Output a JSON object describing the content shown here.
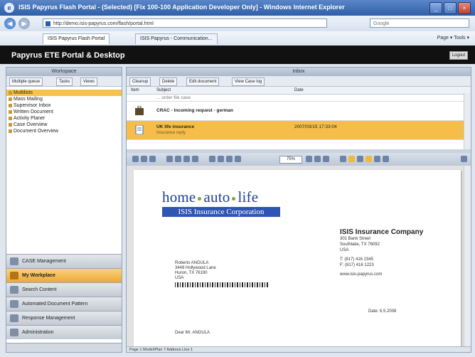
{
  "browser": {
    "title": "ISIS Papyrus Flash Portal - (Selected) [Fix 100-100 Application Developer Only] - Windows Internet Explorer",
    "address": "http://demo.isis-papyrus.com/flash/portal.html",
    "search_placeholder": "Google",
    "tabs": [
      "ISIS Papyrus Flash Portal",
      "ISIS Papyrus - Communication..."
    ],
    "toolbar_text": "Page ▾  Tools ▾"
  },
  "app": {
    "title": "Papyrus ETE Portal & Desktop",
    "logout_label": "Logout"
  },
  "left_panel": {
    "header": "Workspace",
    "buttons": [
      "Multiple queue",
      "Tasks",
      "Views"
    ],
    "tree": [
      {
        "label": "Multilists",
        "selected": true
      },
      {
        "label": "Mass Mailing",
        "selected": false
      },
      {
        "label": "Supervisor Inbox",
        "selected": false
      },
      {
        "label": "Written Document",
        "selected": false
      },
      {
        "label": "Activity Planer",
        "selected": false
      },
      {
        "label": "Case Overview",
        "selected": false
      },
      {
        "label": "Document Overview",
        "selected": false
      }
    ],
    "nav": [
      {
        "label": "CASE Management",
        "active": false
      },
      {
        "label": "My Workplace",
        "active": true
      },
      {
        "label": "Search Content",
        "active": false
      },
      {
        "label": "Automated Document Pattern",
        "active": false
      },
      {
        "label": "Response Management",
        "active": false
      },
      {
        "label": "Administration",
        "active": false
      }
    ]
  },
  "right_panel": {
    "header": "Inbox",
    "buttons": [
      "Cleanup",
      "Delete",
      "Edit document",
      "View Case log"
    ],
    "columns": [
      "Item",
      "Subject",
      "Date"
    ],
    "rows": [
      {
        "subject": "... order file case",
        "from": "",
        "date": ""
      },
      {
        "subject": "CRAC - Incoming request - german",
        "from": "",
        "date": ""
      },
      {
        "subject": "UK life insurance",
        "from": "Insurance reply",
        "date": "2007/03/15 17:33:04"
      }
    ],
    "zoom": "75%",
    "status": "Page 1 Model/Plan 7 Address Line 1"
  },
  "document": {
    "logo_main_1": "home",
    "logo_main_2": "auto",
    "logo_main_3": "life",
    "logo_sub": "ISIS Insurance Corporation",
    "company_name": "ISIS Insurance Company",
    "company_lines": [
      "301 Bank Street",
      "Southlake, TX 76092",
      "USA"
    ],
    "phone_lines": [
      "T: (817) 416 2345",
      "F: (817) 416 1223"
    ],
    "email": "www.isis-papyrus.com",
    "recipient_lines": [
      "Roberto ANGULA",
      "3449 Hollywood Lane",
      "Huron, TX 76190",
      "USA"
    ],
    "date": "Date: 6.5.2008",
    "ref": "Dear Mr. ANGULA"
  },
  "colors": {
    "accent_orange": "#f6bd4a",
    "header_black": "#111111",
    "brand_blue": "#2f55b4"
  }
}
